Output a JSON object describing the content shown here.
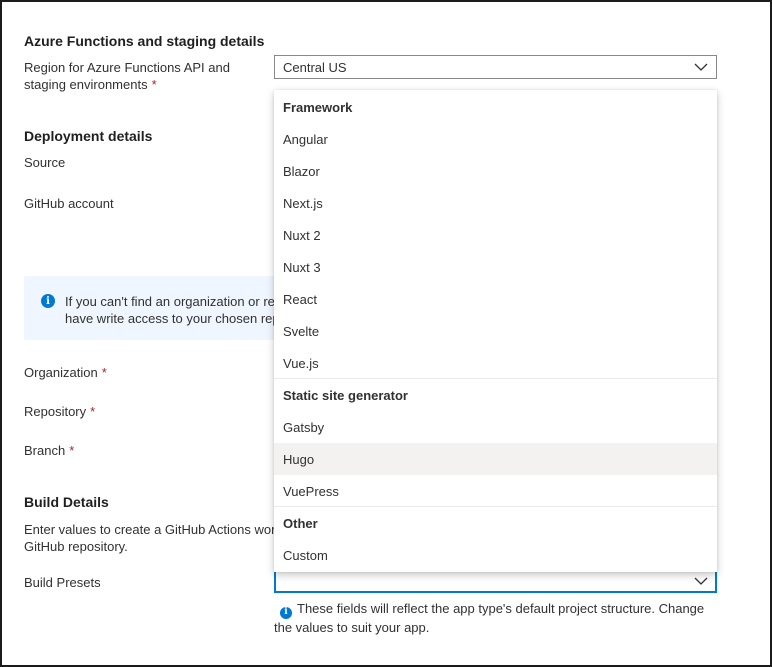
{
  "azure_section": {
    "title": "Azure Functions and staging details",
    "region_label_line1": "Region for Azure Functions API and",
    "region_label_line2": "staging environments",
    "region_value": "Central US"
  },
  "deployment": {
    "title": "Deployment details",
    "source_label": "Source",
    "github_account_label": "GitHub account"
  },
  "info_bar": {
    "line1": "If you can't find an organization or repo",
    "line2": "have write access to your chosen reposi"
  },
  "repo_fields": {
    "organization_label": "Organization",
    "repository_label": "Repository",
    "branch_label": "Branch",
    "required_mark": "*"
  },
  "build": {
    "title": "Build Details",
    "desc_line1": "Enter values to create a GitHub Actions wor",
    "desc_line2": "GitHub repository.",
    "presets_label": "Build Presets",
    "presets_value": "",
    "hint_line1": "These fields will reflect the app type's default project structure. Change",
    "hint_line2": "the values to suit your app."
  },
  "dropdown": {
    "groups": [
      {
        "header": "Framework",
        "items": [
          "Angular",
          "Blazor",
          "Next.js",
          "Nuxt 2",
          "Nuxt 3",
          "React",
          "Svelte",
          "Vue.js"
        ]
      },
      {
        "header": "Static site generator",
        "items": [
          "Gatsby",
          "Hugo",
          "VuePress"
        ]
      },
      {
        "header": "Other",
        "items": [
          "Custom"
        ]
      }
    ],
    "hovered_item": "Hugo"
  },
  "colors": {
    "accent": "#0078d4",
    "required": "#a4262c",
    "info_bg": "#f0f6ff",
    "hover_bg": "#f3f2f1"
  }
}
